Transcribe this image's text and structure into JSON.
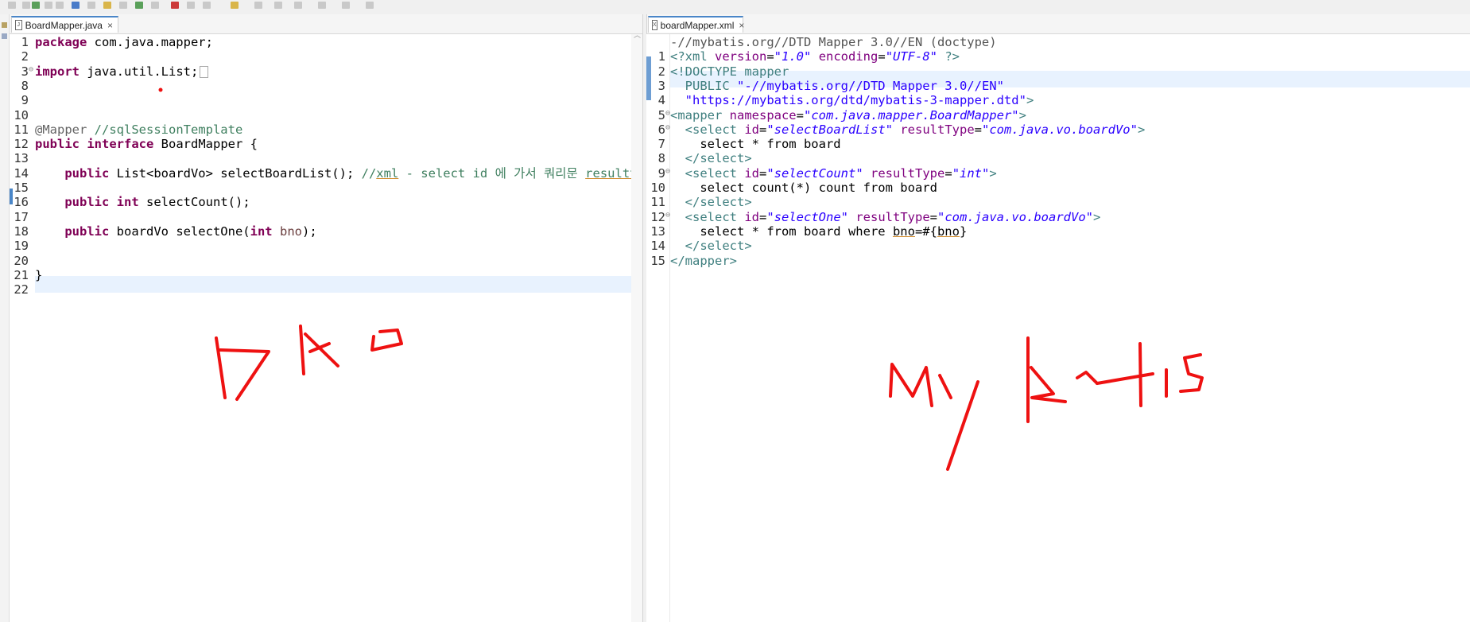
{
  "left_tab": {
    "label": "BoardMapper.java",
    "close": "×"
  },
  "right_tab": {
    "label": "boardMapper.xml",
    "close": "×"
  },
  "left_lines": [
    {
      "n": "1",
      "tokens": [
        {
          "c": "kw",
          "t": "package"
        },
        {
          "c": "pl",
          "t": " com.java.mapper;"
        }
      ]
    },
    {
      "n": "2",
      "tokens": []
    },
    {
      "n": "3",
      "fold": true,
      "tokens": [
        {
          "c": "kw",
          "t": "import"
        },
        {
          "c": "pl",
          "t": " java.util.List;"
        }
      ]
    },
    {
      "n": "8",
      "tokens": []
    },
    {
      "n": "9",
      "tokens": []
    },
    {
      "n": "10",
      "tokens": []
    },
    {
      "n": "11",
      "tokens": [
        {
          "c": "an",
          "t": "@Mapper"
        },
        {
          "c": "pl",
          "t": " "
        },
        {
          "c": "cm",
          "t": "//sqlSessionTemplate"
        }
      ]
    },
    {
      "n": "12",
      "tokens": [
        {
          "c": "kw",
          "t": "public"
        },
        {
          "c": "pl",
          "t": " "
        },
        {
          "c": "kw",
          "t": "interface"
        },
        {
          "c": "pl",
          "t": " BoardMapper {"
        }
      ]
    },
    {
      "n": "13",
      "tokens": []
    },
    {
      "n": "14",
      "tokens": [
        {
          "c": "pl",
          "t": "    "
        },
        {
          "c": "kw",
          "t": "public"
        },
        {
          "c": "pl",
          "t": " List<boardVo> selectBoardList(); "
        },
        {
          "c": "cm",
          "t": "//"
        },
        {
          "c": "cm ul",
          "t": "xml"
        },
        {
          "c": "cm",
          "t": " - select id 에 가서 쿼리문 "
        },
        {
          "c": "cm ul",
          "t": "resulttype"
        }
      ]
    },
    {
      "n": "15",
      "tokens": []
    },
    {
      "n": "16",
      "tokens": [
        {
          "c": "pl",
          "t": "    "
        },
        {
          "c": "kw",
          "t": "public"
        },
        {
          "c": "pl",
          "t": " "
        },
        {
          "c": "kw",
          "t": "int"
        },
        {
          "c": "pl",
          "t": " selectCount();"
        }
      ]
    },
    {
      "n": "17",
      "tokens": []
    },
    {
      "n": "18",
      "tokens": [
        {
          "c": "pl",
          "t": "    "
        },
        {
          "c": "kw",
          "t": "public"
        },
        {
          "c": "pl",
          "t": " boardVo selectOne("
        },
        {
          "c": "kw",
          "t": "int"
        },
        {
          "c": "pl",
          "t": " "
        },
        {
          "c": "var",
          "t": "bno"
        },
        {
          "c": "pl",
          "t": ");"
        }
      ]
    },
    {
      "n": "19",
      "tokens": []
    },
    {
      "n": "20",
      "tokens": []
    },
    {
      "n": "21",
      "tokens": [
        {
          "c": "pl",
          "t": "}"
        }
      ]
    },
    {
      "n": "22",
      "tokens": []
    }
  ],
  "right_lines": [
    {
      "n": "",
      "tokens": [
        {
          "c": "dtgray",
          "t": "-//mybatis.org//DTD Mapper 3.0//EN (doctype)"
        }
      ]
    },
    {
      "n": "1",
      "tokens": [
        {
          "c": "tag",
          "t": "<?xml "
        },
        {
          "c": "attr",
          "t": "version"
        },
        {
          "c": "pl",
          "t": "="
        },
        {
          "c": "aval",
          "t": "\"1.0\""
        },
        {
          "c": "pl",
          "t": " "
        },
        {
          "c": "attr",
          "t": "encoding"
        },
        {
          "c": "pl",
          "t": "="
        },
        {
          "c": "aval",
          "t": "\"UTF-8\""
        },
        {
          "c": "tag",
          "t": " ?>"
        }
      ]
    },
    {
      "n": "2",
      "tokens": [
        {
          "c": "tag",
          "t": "<!DOCTYPE mapper"
        }
      ]
    },
    {
      "n": "3",
      "tokens": [
        {
          "c": "dt",
          "t": "  PUBLIC "
        },
        {
          "c": "str",
          "t": "\"-//mybatis.org//DTD Mapper 3.0//EN\""
        }
      ]
    },
    {
      "n": "4",
      "tokens": [
        {
          "c": "str",
          "t": "  \"https://mybatis.org/dtd/mybatis-3-mapper.dtd\""
        },
        {
          "c": "tag",
          "t": ">"
        }
      ]
    },
    {
      "n": "5",
      "fold": true,
      "tokens": [
        {
          "c": "tag",
          "t": "<mapper "
        },
        {
          "c": "attr",
          "t": "namespace"
        },
        {
          "c": "pl",
          "t": "="
        },
        {
          "c": "aval",
          "t": "\"com.java.mapper.BoardMapper\""
        },
        {
          "c": "tag",
          "t": ">"
        }
      ]
    },
    {
      "n": "6",
      "fold": true,
      "tokens": [
        {
          "c": "tag",
          "t": "  <select "
        },
        {
          "c": "attr",
          "t": "id"
        },
        {
          "c": "pl",
          "t": "="
        },
        {
          "c": "aval",
          "t": "\"selectBoardList\""
        },
        {
          "c": "pl",
          "t": " "
        },
        {
          "c": "attr",
          "t": "resultType"
        },
        {
          "c": "pl",
          "t": "="
        },
        {
          "c": "aval",
          "t": "\"com.java.vo.boardVo\""
        },
        {
          "c": "tag",
          "t": ">"
        }
      ]
    },
    {
      "n": "7",
      "tokens": [
        {
          "c": "pl",
          "t": "    select * from board"
        }
      ]
    },
    {
      "n": "8",
      "tokens": [
        {
          "c": "tag",
          "t": "  </select>"
        }
      ]
    },
    {
      "n": "9",
      "fold": true,
      "tokens": [
        {
          "c": "tag",
          "t": "  <select "
        },
        {
          "c": "attr",
          "t": "id"
        },
        {
          "c": "pl",
          "t": "="
        },
        {
          "c": "aval",
          "t": "\"selectCount\""
        },
        {
          "c": "pl",
          "t": " "
        },
        {
          "c": "attr",
          "t": "resultType"
        },
        {
          "c": "pl",
          "t": "="
        },
        {
          "c": "aval",
          "t": "\"int\""
        },
        {
          "c": "tag",
          "t": ">"
        }
      ]
    },
    {
      "n": "10",
      "tokens": [
        {
          "c": "pl",
          "t": "    select count(*) count from board"
        }
      ]
    },
    {
      "n": "11",
      "tokens": [
        {
          "c": "tag",
          "t": "  </select>"
        }
      ]
    },
    {
      "n": "12",
      "fold": true,
      "tokens": [
        {
          "c": "tag",
          "t": "  <select "
        },
        {
          "c": "attr",
          "t": "id"
        },
        {
          "c": "pl",
          "t": "="
        },
        {
          "c": "aval",
          "t": "\"selectOne\""
        },
        {
          "c": "pl",
          "t": " "
        },
        {
          "c": "attr",
          "t": "resultType"
        },
        {
          "c": "pl",
          "t": "="
        },
        {
          "c": "aval",
          "t": "\"com.java.vo.boardVo\""
        },
        {
          "c": "tag",
          "t": ">"
        }
      ]
    },
    {
      "n": "13",
      "tokens": [
        {
          "c": "pl",
          "t": "    select * from board where "
        },
        {
          "c": "pl ul",
          "t": "bno"
        },
        {
          "c": "pl",
          "t": "=#{"
        },
        {
          "c": "pl ul",
          "t": "bno"
        },
        {
          "c": "pl",
          "t": "}"
        }
      ]
    },
    {
      "n": "14",
      "tokens": [
        {
          "c": "tag",
          "t": "  </select>"
        }
      ]
    },
    {
      "n": "15",
      "tokens": [
        {
          "c": "tag",
          "t": "</mapper>"
        }
      ]
    }
  ],
  "handwriting": {
    "left": "DAO",
    "right": "MyBatis",
    "color": "#ee1111"
  },
  "colors": {
    "keyword": "#7f0055",
    "comment": "#3f7f5f",
    "string": "#2a00ff",
    "tag": "#3f7f7f",
    "attr": "#7f007f",
    "highlight": "#e8f2fe",
    "marker": "#4a86c8"
  }
}
